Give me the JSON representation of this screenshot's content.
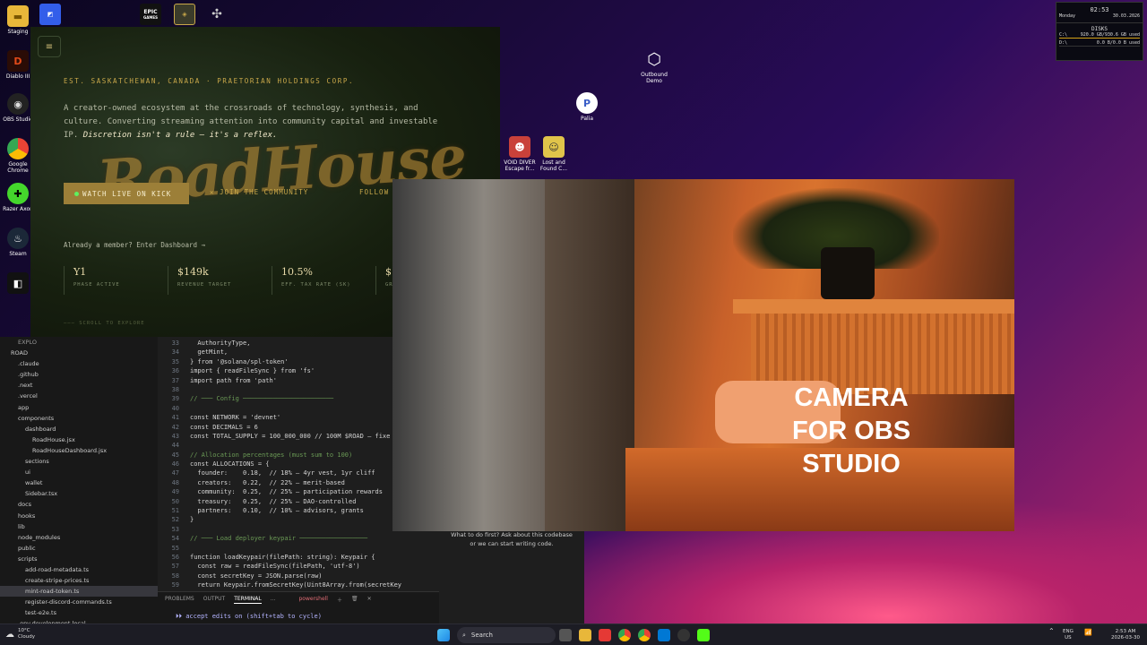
{
  "desktop_icons": [
    {
      "name": "staging-folder-icon",
      "label": "Staging"
    },
    {
      "name": "diablo-icon",
      "label": "Diablo III"
    },
    {
      "name": "obs-studio-icon",
      "label": "OBS Studio"
    },
    {
      "name": "google-chrome-icon",
      "label": "Google Chrome"
    },
    {
      "name": "razer-axon-icon",
      "label": "Razer Axon"
    },
    {
      "name": "steam-icon",
      "label": "Steam"
    },
    {
      "name": "outbound-demo-icon",
      "label": "Outbound Demo"
    },
    {
      "name": "palia-icon",
      "label": "Palia"
    },
    {
      "name": "void-diver-icon",
      "label": "VOID DIVER Escape fr..."
    },
    {
      "name": "lost-and-found-icon",
      "label": "Lost and Found C..."
    }
  ],
  "top_icons": {
    "epic": "EPIC",
    "epic_sub": "GAMES"
  },
  "widget": {
    "time": "02:53",
    "day": "Monday",
    "date": "30.03.2026",
    "disks_title": "DISKS",
    "disk1_label": "C:\\",
    "disk1_value": "920.0 GB/930.6 GB used",
    "disk2_label": "D:\\",
    "disk2_value": "0.0 B/0.0 B used"
  },
  "roadhouse": {
    "menu_glyph": "≡",
    "est": "EST. SASKATCHEWAN, CANADA · PRAETORIAN HOLDINGS CORP.",
    "desc_plain": "A creator-owned ecosystem at the crossroads of technology, synthesis, and culture. Converting streaming attention into community capital and investable IP. ",
    "desc_italic": "Discretion isn't a rule — it's a reflex.",
    "logo": "RoadHouse",
    "watch_btn": "WATCH LIVE ON KICK",
    "join_btn": "✕ JOIN THE COMMUNITY",
    "follow_btn": "FOLLOW",
    "member_link": "Already a member? Enter Dashboard →",
    "stats": [
      {
        "value": "Y1",
        "label": "PHASE ACTIVE"
      },
      {
        "value": "$149k",
        "label": "REVENUE TARGET"
      },
      {
        "value": "10.5%",
        "label": "EFF. TAX RATE (SK)"
      },
      {
        "value": "$",
        "label": "GR"
      }
    ],
    "scroll": "——— SCROLL TO EXPLORE"
  },
  "explorer": {
    "header": "EXPLO",
    "items": [
      "ROAD",
      "  .claude",
      "  .github",
      "  .next",
      "  .vercel",
      "  app",
      "  components",
      "    dashboard",
      "      RoadHouse.jsx",
      "      RoadHouseDashboard.jsx",
      "    sections",
      "    ui",
      "    wallet",
      "    Sidebar.tsx",
      "  docs",
      "  hooks",
      "  lib",
      "  node_modules",
      "  public",
      "  scripts",
      "    add-road-metadata.ts",
      "    create-stripe-prices.ts",
      "    mint-road-token.ts",
      "    register-discord-commands.ts",
      "    test-e2e.ts",
      "  .env.development.local",
      "  .env.example",
      "  .env.local"
    ]
  },
  "code_lines": [
    {
      "n": "33",
      "t": "  AuthorityType,"
    },
    {
      "n": "34",
      "t": "  getMint,"
    },
    {
      "n": "35",
      "t": "} from '@solana/spl-token'"
    },
    {
      "n": "36",
      "t": "import { readFileSync } from 'fs'"
    },
    {
      "n": "37",
      "t": "import path from 'path'"
    },
    {
      "n": "38",
      "t": ""
    },
    {
      "n": "39",
      "t": "// ─── Config ────────────────────────"
    },
    {
      "n": "40",
      "t": ""
    },
    {
      "n": "41",
      "t": "const NETWORK = 'devnet'"
    },
    {
      "n": "42",
      "t": "const DECIMALS = 6"
    },
    {
      "n": "43",
      "t": "const TOTAL_SUPPLY = 100_000_000 // 100M $ROAD — fixe"
    },
    {
      "n": "44",
      "t": ""
    },
    {
      "n": "45",
      "t": "// Allocation percentages (must sum to 100)"
    },
    {
      "n": "46",
      "t": "const ALLOCATIONS = {"
    },
    {
      "n": "47",
      "t": "  founder:    0.18,  // 18% — 4yr vest, 1yr cliff"
    },
    {
      "n": "48",
      "t": "  creators:   0.22,  // 22% — merit-based"
    },
    {
      "n": "49",
      "t": "  community:  0.25,  // 25% — participation rewards"
    },
    {
      "n": "50",
      "t": "  treasury:   0.25,  // 25% — DAO-controlled"
    },
    {
      "n": "51",
      "t": "  partners:   0.10,  // 10% — advisors, grants"
    },
    {
      "n": "52",
      "t": "}"
    },
    {
      "n": "53",
      "t": ""
    },
    {
      "n": "54",
      "t": "// ─── Load deployer keypair ──────────────────"
    },
    {
      "n": "55",
      "t": ""
    },
    {
      "n": "56",
      "t": "function loadKeypair(filePath: string): Keypair {"
    },
    {
      "n": "57",
      "t": "  const raw = readFileSync(filePath, 'utf-8')"
    },
    {
      "n": "58",
      "t": "  const secretKey = JSON.parse(raw)"
    },
    {
      "n": "59",
      "t": "  return Keypair.fromSecretKey(Uint8Array.from(secretKey"
    }
  ],
  "panel": {
    "tab1": "PROBLEMS",
    "tab2": "OUTPUT",
    "tab3": "TERMINAL",
    "tab4": "...",
    "shell": "powershell",
    "terminal_text": "⏵⏵ accept edits on (shift+tab to cycle)"
  },
  "chat": {
    "prompt": "What to do first? Ask about this codebase or we can start writing code."
  },
  "camera": {
    "label_line1": "CAMERA",
    "label_line2": "FOR OBS",
    "label_line3": "STUDIO"
  },
  "taskbar": {
    "weather_temp": "10°C",
    "weather_desc": "Cloudy",
    "search": "Search",
    "lang1": "ENG",
    "lang2": "US",
    "time": "2:53 AM",
    "date": "2026-03-30"
  }
}
